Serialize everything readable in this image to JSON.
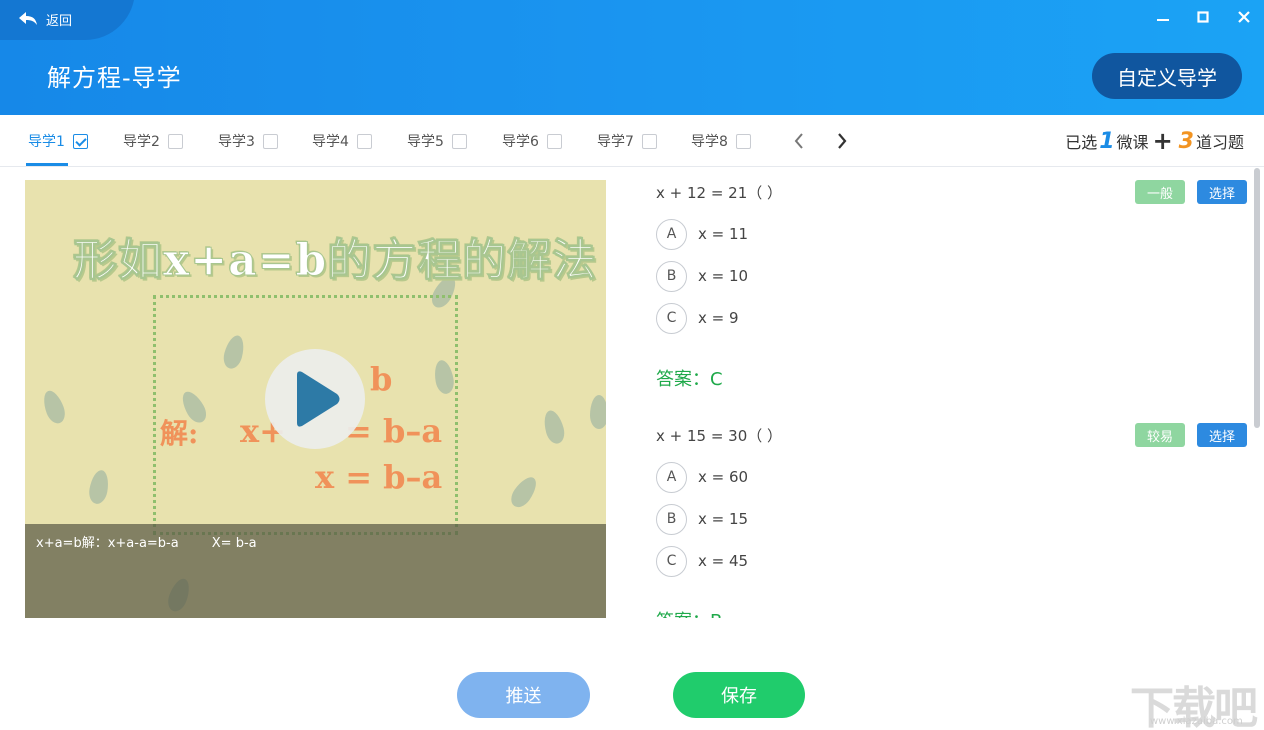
{
  "header": {
    "back_label": "返回",
    "title": "解方程-导学",
    "custom_button": "自定义导学"
  },
  "tabs": [
    {
      "label": "导学1",
      "checked": true
    },
    {
      "label": "导学2",
      "checked": false
    },
    {
      "label": "导学3",
      "checked": false
    },
    {
      "label": "导学4",
      "checked": false
    },
    {
      "label": "导学5",
      "checked": false
    },
    {
      "label": "导学6",
      "checked": false
    },
    {
      "label": "导学7",
      "checked": false
    },
    {
      "label": "导学8",
      "checked": false
    }
  ],
  "summary": {
    "prefix": "已选",
    "micro_count": "1",
    "micro_label": "微课",
    "plus": "+",
    "question_count": "3",
    "question_label": "道习题"
  },
  "video": {
    "title": "形如x+a=b的方程的解法",
    "eq_line1": "b",
    "eq_line2_prefix": "解:",
    "eq_line2_left": "x+",
    "eq_line2_right": "= b–a",
    "eq_line3": "x = b–a",
    "subtitle": "x+a=b解：x+a-a=b-a        X= b-a"
  },
  "questions": [
    {
      "text": "x + 12 = 21（   ）",
      "level": "一般",
      "select_label": "选择",
      "options": [
        {
          "letter": "A",
          "text": "x = 11"
        },
        {
          "letter": "B",
          "text": "x = 10"
        },
        {
          "letter": "C",
          "text": "x = 9"
        }
      ],
      "answer": "答案：C"
    },
    {
      "text": "x + 15 = 30（   ）",
      "level": "较易",
      "select_label": "选择",
      "options": [
        {
          "letter": "A",
          "text": "x = 60"
        },
        {
          "letter": "B",
          "text": "x = 15"
        },
        {
          "letter": "C",
          "text": "x = 45"
        }
      ],
      "answer": "答案：B"
    }
  ],
  "footer": {
    "push_label": "推送",
    "save_label": "保存"
  },
  "watermark": {
    "main": "下载吧",
    "sub": "www.xiazaiba.com"
  },
  "colors": {
    "header_blue": "#1a95f0",
    "accent_blue": "#1a8ce6",
    "answer_green": "#1fa94a",
    "save_green": "#20cc6c",
    "count_orange": "#f29422"
  }
}
